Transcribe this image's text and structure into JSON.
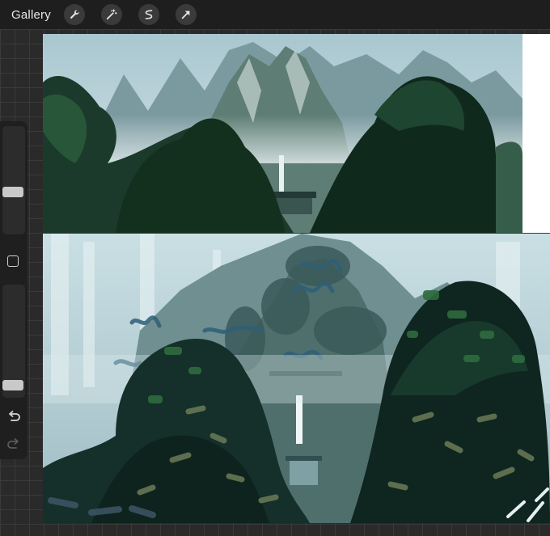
{
  "toolbar": {
    "gallery_label": "Gallery",
    "tools": [
      {
        "name": "wrench-icon"
      },
      {
        "name": "magic-wand-icon"
      },
      {
        "name": "selection-icon"
      },
      {
        "name": "transform-arrow-icon"
      }
    ]
  },
  "sidebar": {
    "brush_size": 0.38,
    "opacity": 0.07,
    "buttons": [
      "modify-button",
      "undo-icon",
      "redo-icon"
    ]
  },
  "colors": {
    "toolbar_bg": "#1e1e1e",
    "sidebar_bg": "#1f1f1f",
    "canvas_grid_bg": "#2a2a2a",
    "mist": "#b9d2d8",
    "forest_dark": "#0f2a22",
    "forest_green": "#2f5a3e"
  }
}
